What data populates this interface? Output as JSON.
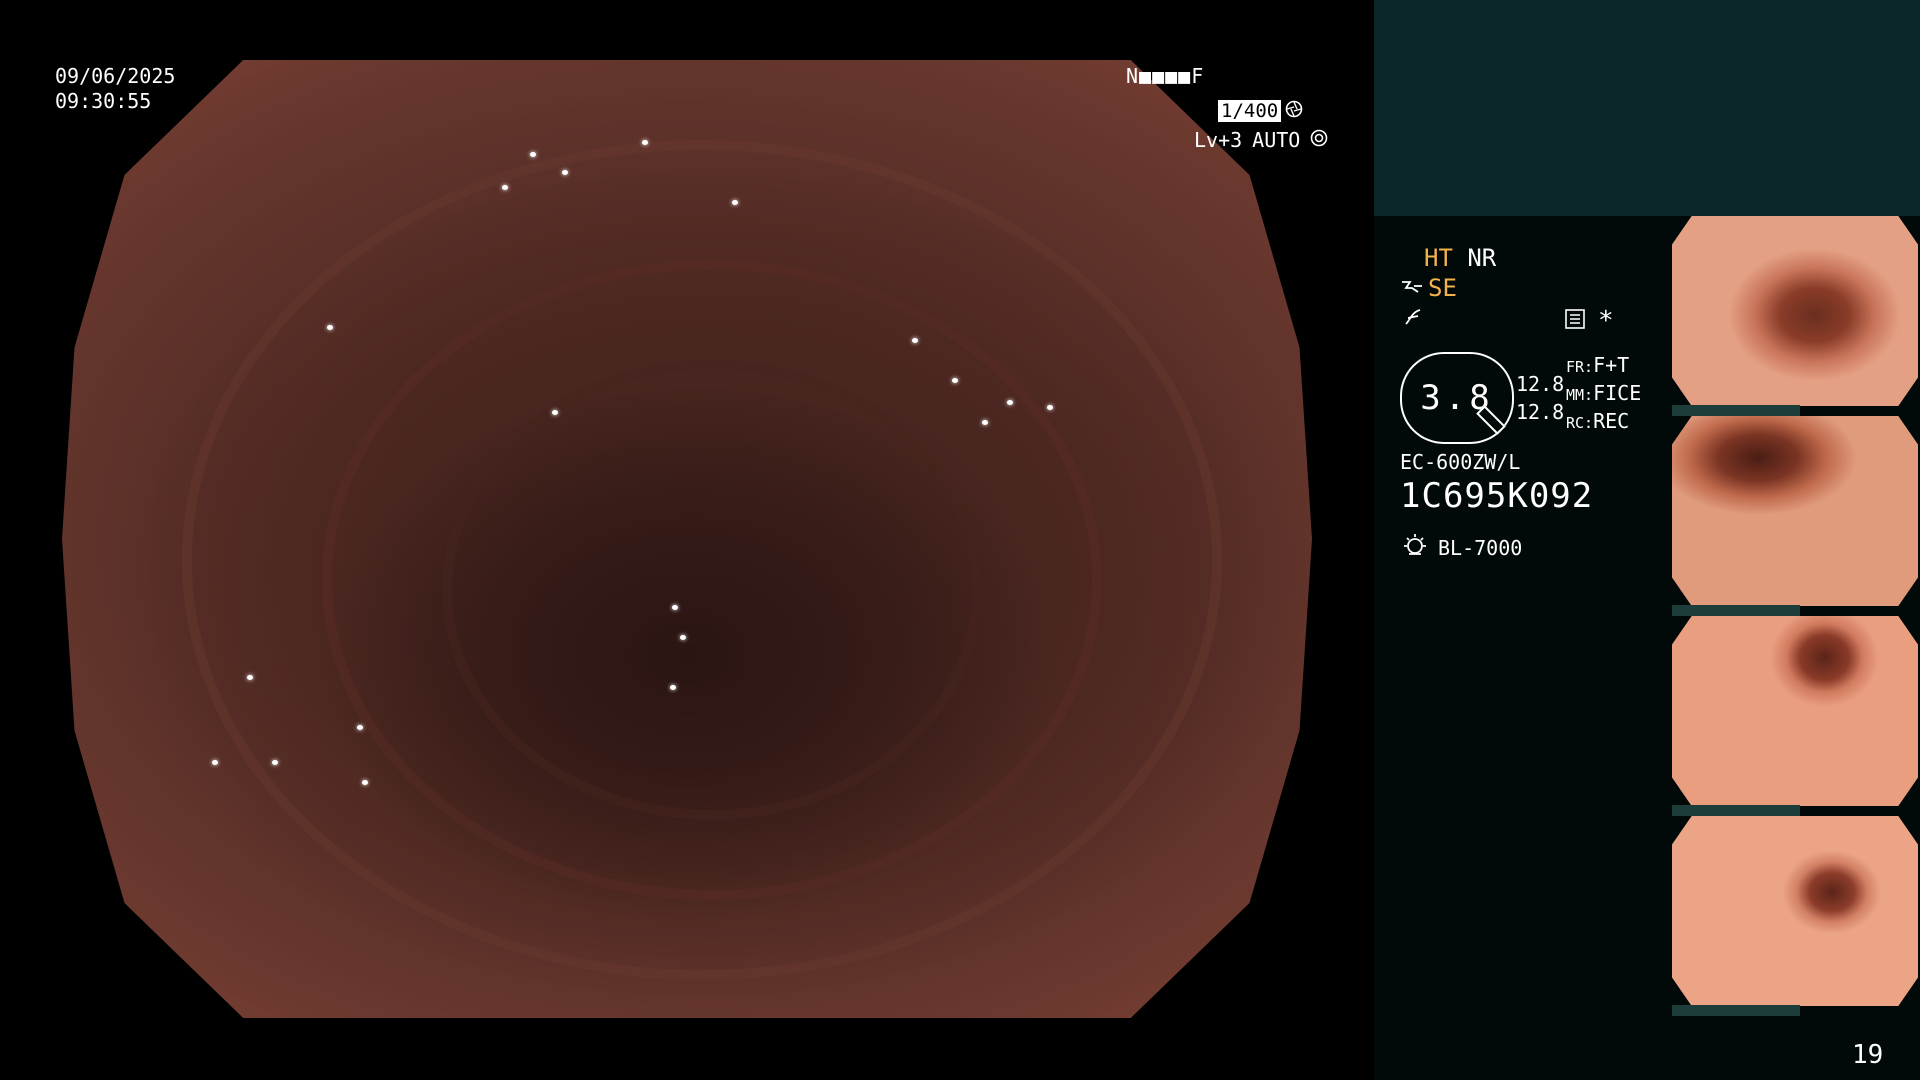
{
  "osd": {
    "date": "09/06/2025",
    "time": "09:30:55",
    "iris_mode": "N■■■■F",
    "shutter": "1/400",
    "light_level": "Lv+3",
    "exposure_mode": "AUTO"
  },
  "panel": {
    "ht": "HT",
    "nr": "NR",
    "se": "SE",
    "zoom": "3.8",
    "value_top": "12.8",
    "value_bottom": "12.8",
    "fr_label": "FR:",
    "fr_value": "F+T",
    "mm_label": "MM:",
    "mm_value": "FICE",
    "rc_label": "RC:",
    "rc_value": "REC",
    "scope_model": "EC-600ZW/L",
    "serial": "1C695K092",
    "light_source": "BL-7000",
    "star": "*",
    "page_number": "19"
  },
  "icons": {
    "shutter": "aperture-icon",
    "auto": "auto-exposure-icon",
    "se": "scope-tip-icon",
    "enhance": "enhancement-icon",
    "memory": "memory-card-icon",
    "light": "lamp-icon"
  },
  "colors": {
    "highlight": "#f3b24a",
    "panel_top": "#0b2626",
    "panel": "#020909"
  }
}
